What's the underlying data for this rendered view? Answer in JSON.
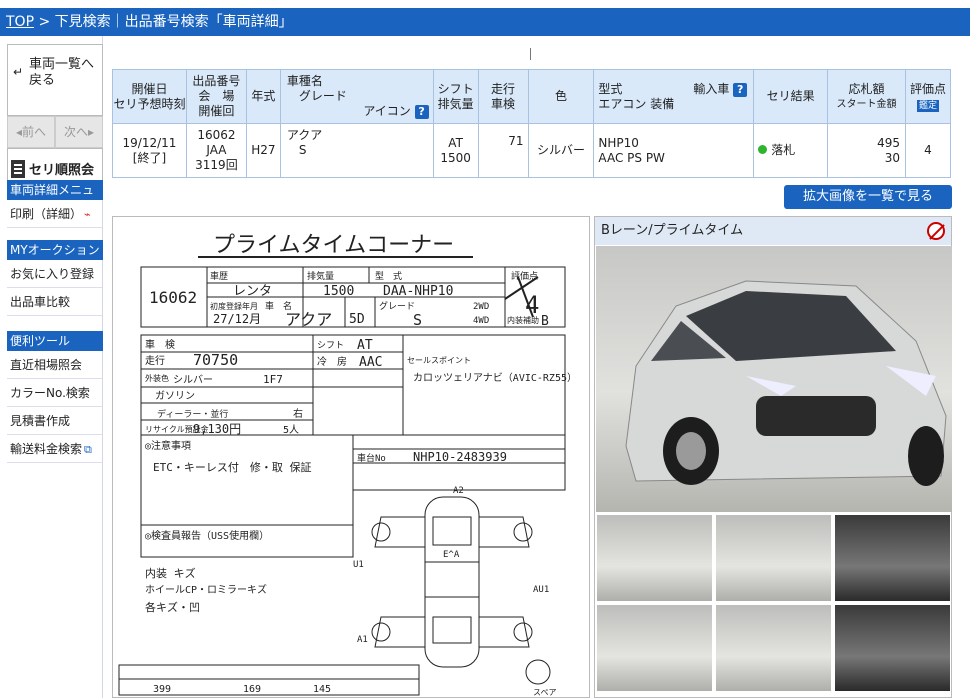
{
  "breadcrumb": {
    "top": "TOP",
    "sep": ">",
    "path": "下見検索｜出品番号検索「車両詳細」"
  },
  "sidebar": {
    "back_label_1": "車両一覧へ",
    "back_label_2": "戻る",
    "prev": "◂前へ",
    "next": "次へ▸",
    "seri_label": "セリ順照会",
    "menu1_head": "車両詳細メニュー",
    "print_label": "印刷（詳細）",
    "my_head": "MYオークション",
    "favorites": "お気に入り登録",
    "compare": "出品車比較",
    "tools_head": "便利ツール",
    "market": "直近相場照会",
    "color_search": "カラーNo.検索",
    "estimate": "見積書作成",
    "shipping": "輸送料金検索"
  },
  "table": {
    "h_date_1": "開催日",
    "h_date_2": "セリ予想時刻",
    "h_lot_1": "出品番号",
    "h_lot_2": "会　場",
    "h_lot_3": "開催回",
    "h_year": "年式",
    "h_name_1": "車種名",
    "h_name_2": "グレード",
    "h_name_3": "アイコン",
    "h_shift_1": "シフト",
    "h_shift_2": "排気量",
    "h_mileage_1": "走行",
    "h_mileage_2": "車検",
    "h_color": "色",
    "h_model_1": "型式",
    "h_model_2": "エアコン 装備",
    "h_import": "輸入車",
    "h_result": "セリ結果",
    "h_price_1": "応札額",
    "h_price_2": "スタート金額",
    "h_score": "評価点",
    "h_score_tag": "鑑定",
    "row": {
      "date": "19/12/11",
      "status": "[終了]",
      "lot": "16062",
      "venue": "JAA",
      "session": "3119回",
      "year": "H27",
      "name": "アクア",
      "grade": "S",
      "shift": "AT",
      "displacement": "1500",
      "mileage": "71",
      "color": "シルバー",
      "model": "NHP10",
      "equipment": "AAC PS PW",
      "result": "落札",
      "bid": "495",
      "start": "30",
      "score": "4"
    }
  },
  "expand_button": "拡大画像を一覧で見る",
  "photo_title": "Bレーン/プライムタイム",
  "sheet": {
    "title": "プライムタイムコーナー",
    "lot": "16062",
    "car_history_label": "車歴",
    "car_history": "レンタ",
    "displacement_label": "排気量",
    "displacement": "1500",
    "model_label": "型　式",
    "model": "DAA-NHP10",
    "score_label": "評価点",
    "score": "4",
    "reg_year_label": "初度登録年月",
    "reg_year": "27/12月",
    "car_name_label": "車　名",
    "car_name": "アクア",
    "doors": "5D",
    "grade_label": "グレード",
    "grade": "S",
    "drive_2wd": "2WD",
    "drive_4wd": "4WD",
    "interior_label": "内装補助",
    "interior": "B",
    "inspection_label": "車　検",
    "mileage_label": "走行",
    "mileage": "70750",
    "shift_label": "シフト",
    "shift": "AT",
    "aircon_label": "冷　房",
    "aircon": "AAC",
    "color_label": "外装色",
    "color_body": "シルバー",
    "color_no": "1F7",
    "fuel": "ガソリン",
    "handle": "右",
    "recycle_label": "リサイクル預託金",
    "recycle": "9,130円",
    "seats": "5人",
    "dealer": "ディーラー・並行",
    "points_label": "セールスポイント",
    "points": "カロッツェリアナビ（AVIC-RZ55）",
    "chassis_label": "車台No",
    "chassis": "NHP10-2483939",
    "notes_label": "◎注意事項",
    "notes": "ETC・キーレス付　修・取 保証",
    "inspector_label": "◎検査員報告（USS使用欄）",
    "report_1": "内装 キズ",
    "report_2": "ホイールCP・ロミラーキズ",
    "report_3": "各キズ・凹",
    "size_len": "399",
    "size_w": "169",
    "size_h": "145",
    "map_a2": "A2",
    "map_ea": "E^A",
    "map_a1": "A1",
    "map_u1": "U1",
    "map_au1": "AU1",
    "spare": "スペア"
  }
}
